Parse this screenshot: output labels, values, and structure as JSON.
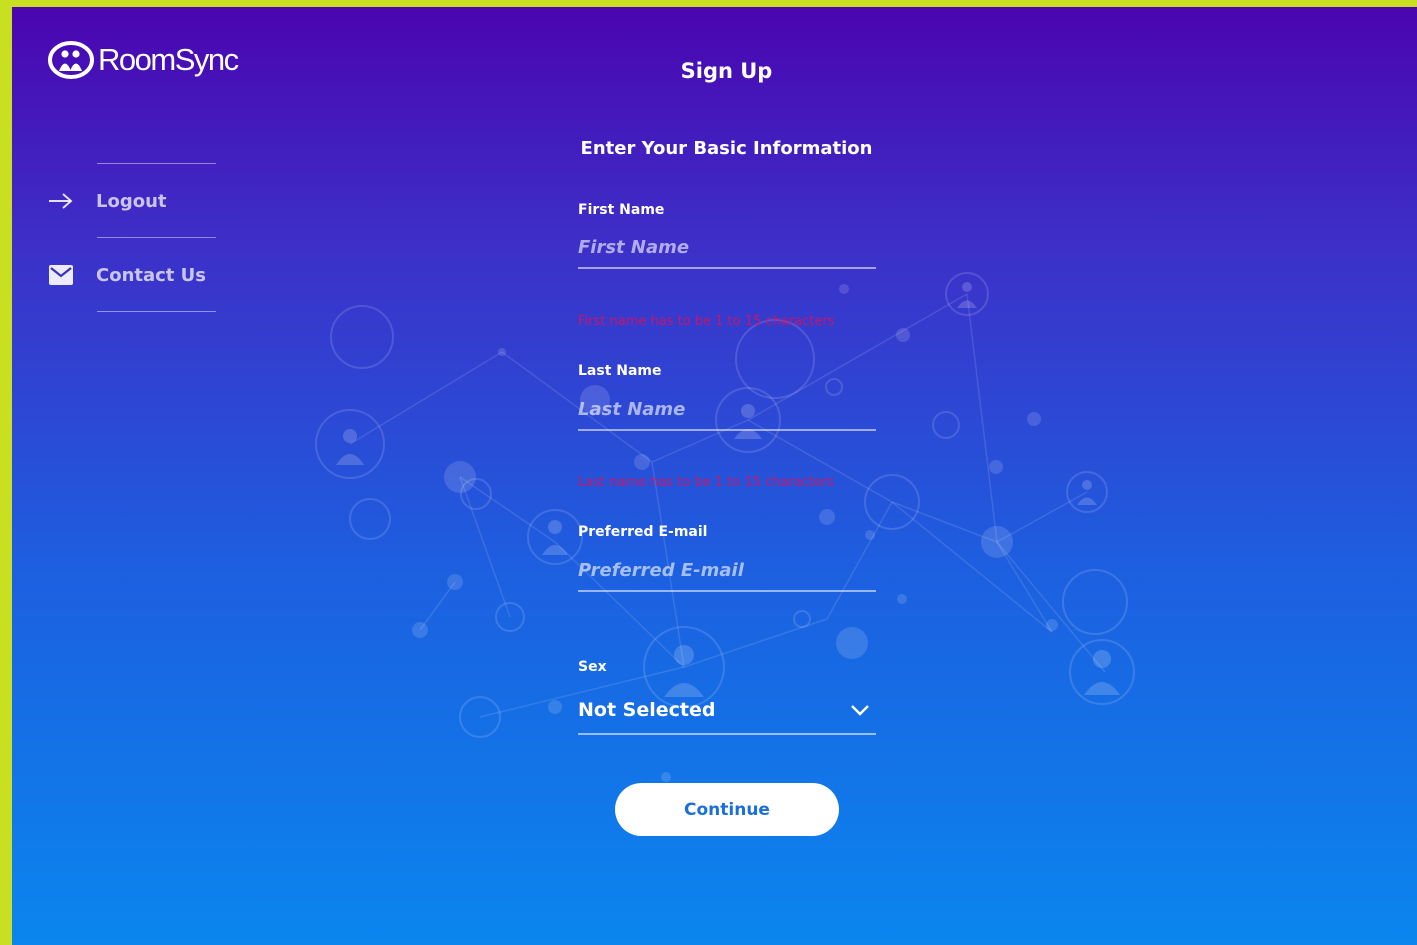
{
  "brand": {
    "name": "RoomSync"
  },
  "sidebar": {
    "items": [
      {
        "label": "Logout",
        "icon": "arrow-right-icon"
      },
      {
        "label": "Contact Us",
        "icon": "envelope-icon"
      }
    ]
  },
  "page": {
    "title": "Sign Up",
    "section_title": "Enter Your Basic Information"
  },
  "form": {
    "first_name": {
      "label": "First Name",
      "placeholder": "First Name",
      "value": "",
      "error": "First name has to be 1 to 15 characters"
    },
    "last_name": {
      "label": "Last Name",
      "placeholder": "Last Name",
      "value": "",
      "error": "Last name has to be 1 to 15 characters"
    },
    "email": {
      "label": "Preferred E-mail",
      "placeholder": "Preferred E-mail",
      "value": ""
    },
    "sex": {
      "label": "Sex",
      "selected": "Not Selected"
    },
    "continue_label": "Continue"
  },
  "colors": {
    "gradient_top": "#4a05b0",
    "gradient_bottom": "#0a86ee",
    "frame": "#c8e021",
    "error": "#e0105a",
    "button_text": "#1b6fd8"
  }
}
